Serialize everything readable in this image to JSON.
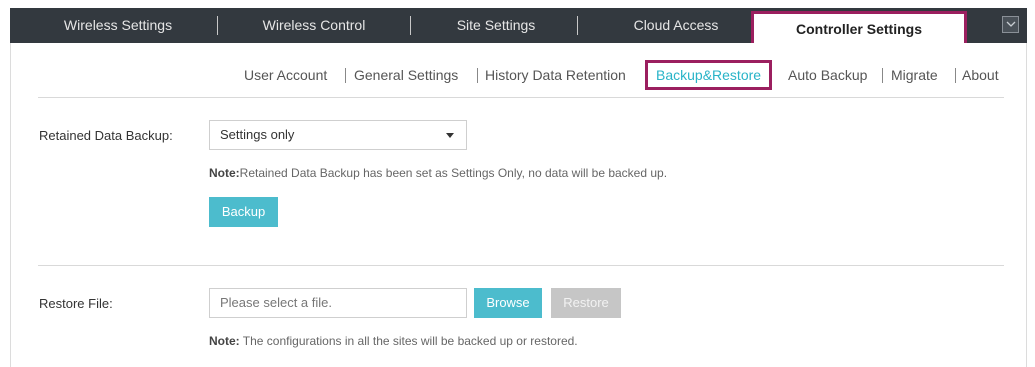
{
  "top_nav": {
    "tabs": [
      {
        "label": "Wireless Settings"
      },
      {
        "label": "Wireless Control"
      },
      {
        "label": "Site Settings"
      },
      {
        "label": "Cloud Access"
      },
      {
        "label": "Controller Settings"
      }
    ],
    "active": "Controller Settings"
  },
  "sub_nav": {
    "items": [
      {
        "label": "User Account"
      },
      {
        "label": "General Settings"
      },
      {
        "label": "History Data Retention"
      },
      {
        "label": "Backup&Restore"
      },
      {
        "label": "Auto Backup"
      },
      {
        "label": "Migrate"
      },
      {
        "label": "About"
      }
    ],
    "active": "Backup&Restore"
  },
  "backup": {
    "label": "Retained Data Backup:",
    "selected": "Settings only",
    "note_prefix": "Note:",
    "note_text": "Retained Data Backup has been set as Settings Only, no data will be backed up.",
    "button": "Backup"
  },
  "restore": {
    "label": "Restore File:",
    "placeholder": "Please select a file.",
    "browse_button": "Browse",
    "restore_button": "Restore",
    "note_prefix": "Note:",
    "note_text": " The configurations in all the sites will be backed up or restored."
  },
  "colors": {
    "nav_bg": "#33393f",
    "accent": "#4cbccd",
    "highlight_border": "#9b1f5f",
    "active_link": "#29b4c8",
    "disabled": "#c6c6c6"
  },
  "icons": {
    "collapse": "chevron-down-icon",
    "select_caret": "caret-down-icon"
  }
}
